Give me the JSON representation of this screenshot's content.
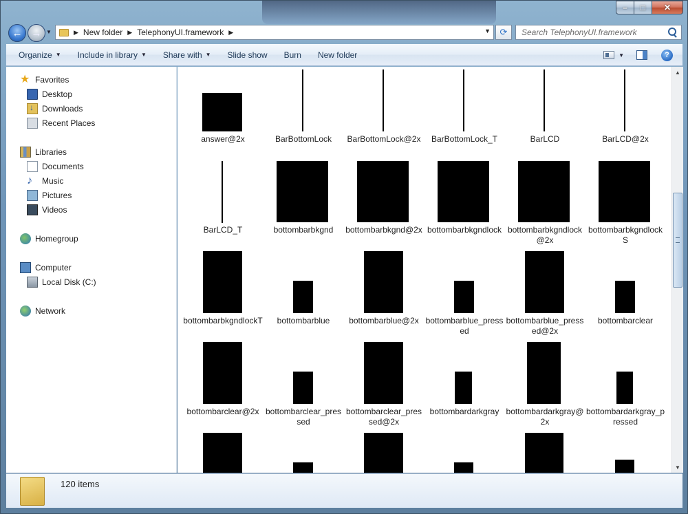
{
  "window": {
    "caption": {
      "minimize": "–",
      "maximize": "□",
      "close": "✕"
    }
  },
  "address_bar": {
    "breadcrumbs": [
      "New folder",
      "TelephonyUI.framework"
    ],
    "search_placeholder": "Search TelephonyUI.framework"
  },
  "toolbar": {
    "organize": "Organize",
    "include_in_library": "Include in library",
    "share_with": "Share with",
    "slide_show": "Slide show",
    "burn": "Burn",
    "new_folder": "New folder"
  },
  "sidebar": {
    "favorites": "Favorites",
    "desktop": "Desktop",
    "downloads": "Downloads",
    "recent_places": "Recent Places",
    "libraries": "Libraries",
    "documents": "Documents",
    "music": "Music",
    "pictures": "Pictures",
    "videos": "Videos",
    "homegroup": "Homegroup",
    "computer": "Computer",
    "local_disk": "Local Disk (C:)",
    "network": "Network"
  },
  "files": [
    {
      "name": "answer@2x"
    },
    {
      "name": "BarBottomLock"
    },
    {
      "name": "BarBottomLock@2x"
    },
    {
      "name": "BarBottomLock_T"
    },
    {
      "name": "BarLCD"
    },
    {
      "name": "BarLCD@2x"
    },
    {
      "name": "BarLCD_T"
    },
    {
      "name": "bottombarbkgnd"
    },
    {
      "name": "bottombarbkgnd@2x"
    },
    {
      "name": "bottombarbkgndlock"
    },
    {
      "name": "bottombarbkgndlock@2x"
    },
    {
      "name": "bottombarbkgndlockS"
    },
    {
      "name": "bottombarbkgndlockT"
    },
    {
      "name": "bottombarblue"
    },
    {
      "name": "bottombarblue@2x"
    },
    {
      "name": "bottombarblue_pressed"
    },
    {
      "name": "bottombarblue_pressed@2x"
    },
    {
      "name": "bottombarclear"
    },
    {
      "name": "bottombarclear@2x"
    },
    {
      "name": "bottombarclear_pressed"
    },
    {
      "name": "bottombarclear_pressed@2x"
    },
    {
      "name": "bottombardarkgray"
    },
    {
      "name": "bottombardarkgray@2x"
    },
    {
      "name": "bottombardarkgray_pressed"
    }
  ],
  "status": {
    "item_count": "120 items"
  }
}
